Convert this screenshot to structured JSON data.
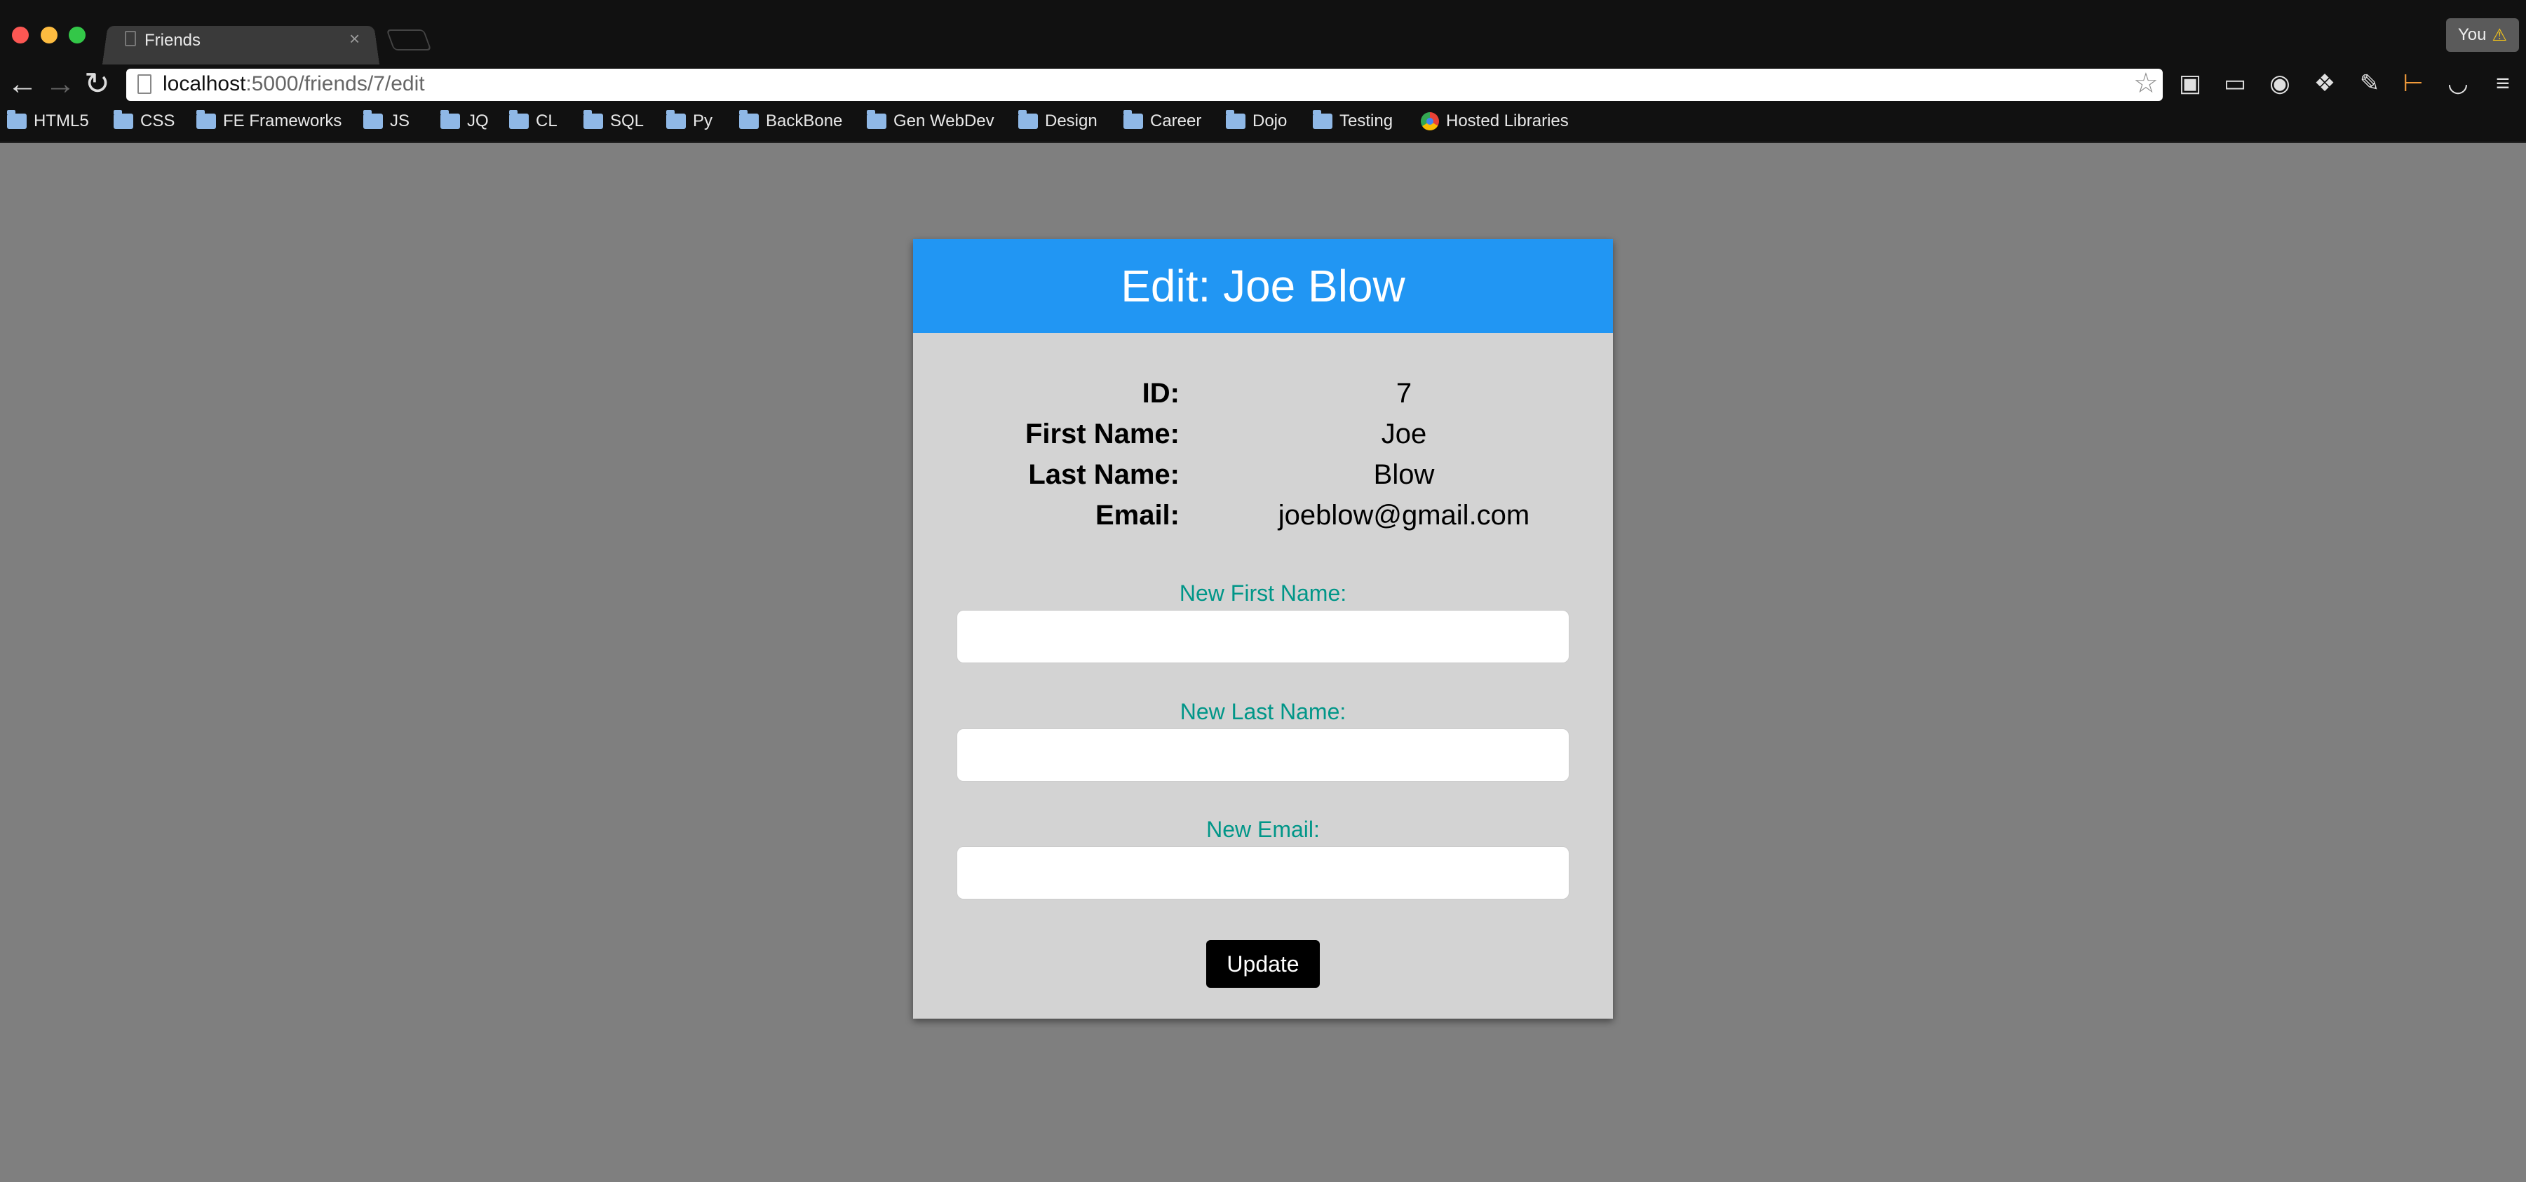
{
  "browser": {
    "tab_title": "Friends",
    "tab_close": "×",
    "url_host": "localhost",
    "url_path": ":5000/friends/7/edit",
    "profile_label": "You",
    "bookmarks": [
      {
        "label": "HTML5",
        "icon": "folder-icon"
      },
      {
        "label": "CSS",
        "icon": "folder-icon"
      },
      {
        "label": "FE Frameworks",
        "icon": "folder-icon"
      },
      {
        "label": "JS",
        "icon": "folder-icon"
      },
      {
        "label": "JQ",
        "icon": "folder-icon"
      },
      {
        "label": "CL",
        "icon": "folder-icon"
      },
      {
        "label": "SQL",
        "icon": "folder-icon"
      },
      {
        "label": "Py",
        "icon": "folder-icon"
      },
      {
        "label": "BackBone",
        "icon": "folder-icon"
      },
      {
        "label": "Gen WebDev",
        "icon": "folder-icon"
      },
      {
        "label": "Design",
        "icon": "folder-icon"
      },
      {
        "label": "Career",
        "icon": "folder-icon"
      },
      {
        "label": "Dojo",
        "icon": "folder-icon"
      },
      {
        "label": "Testing",
        "icon": "folder-icon"
      },
      {
        "label": "Hosted Libraries",
        "icon": "globe-icon"
      }
    ]
  },
  "page": {
    "header": "Edit: Joe Blow",
    "info": [
      {
        "label": "ID:",
        "value": "7"
      },
      {
        "label": "First Name:",
        "value": "Joe"
      },
      {
        "label": "Last Name:",
        "value": "Blow"
      },
      {
        "label": "Email:",
        "value": "joeblow@gmail.com"
      }
    ],
    "fields": [
      {
        "label": "New First Name:",
        "value": ""
      },
      {
        "label": "New Last Name:",
        "value": ""
      },
      {
        "label": "New Email:",
        "value": ""
      }
    ],
    "update_label": "Update"
  },
  "colors": {
    "page_background": "#7f7f7f",
    "header": "#2196f3",
    "card": "#d3d3d3",
    "field_label": "#009688",
    "button": "#000000"
  }
}
